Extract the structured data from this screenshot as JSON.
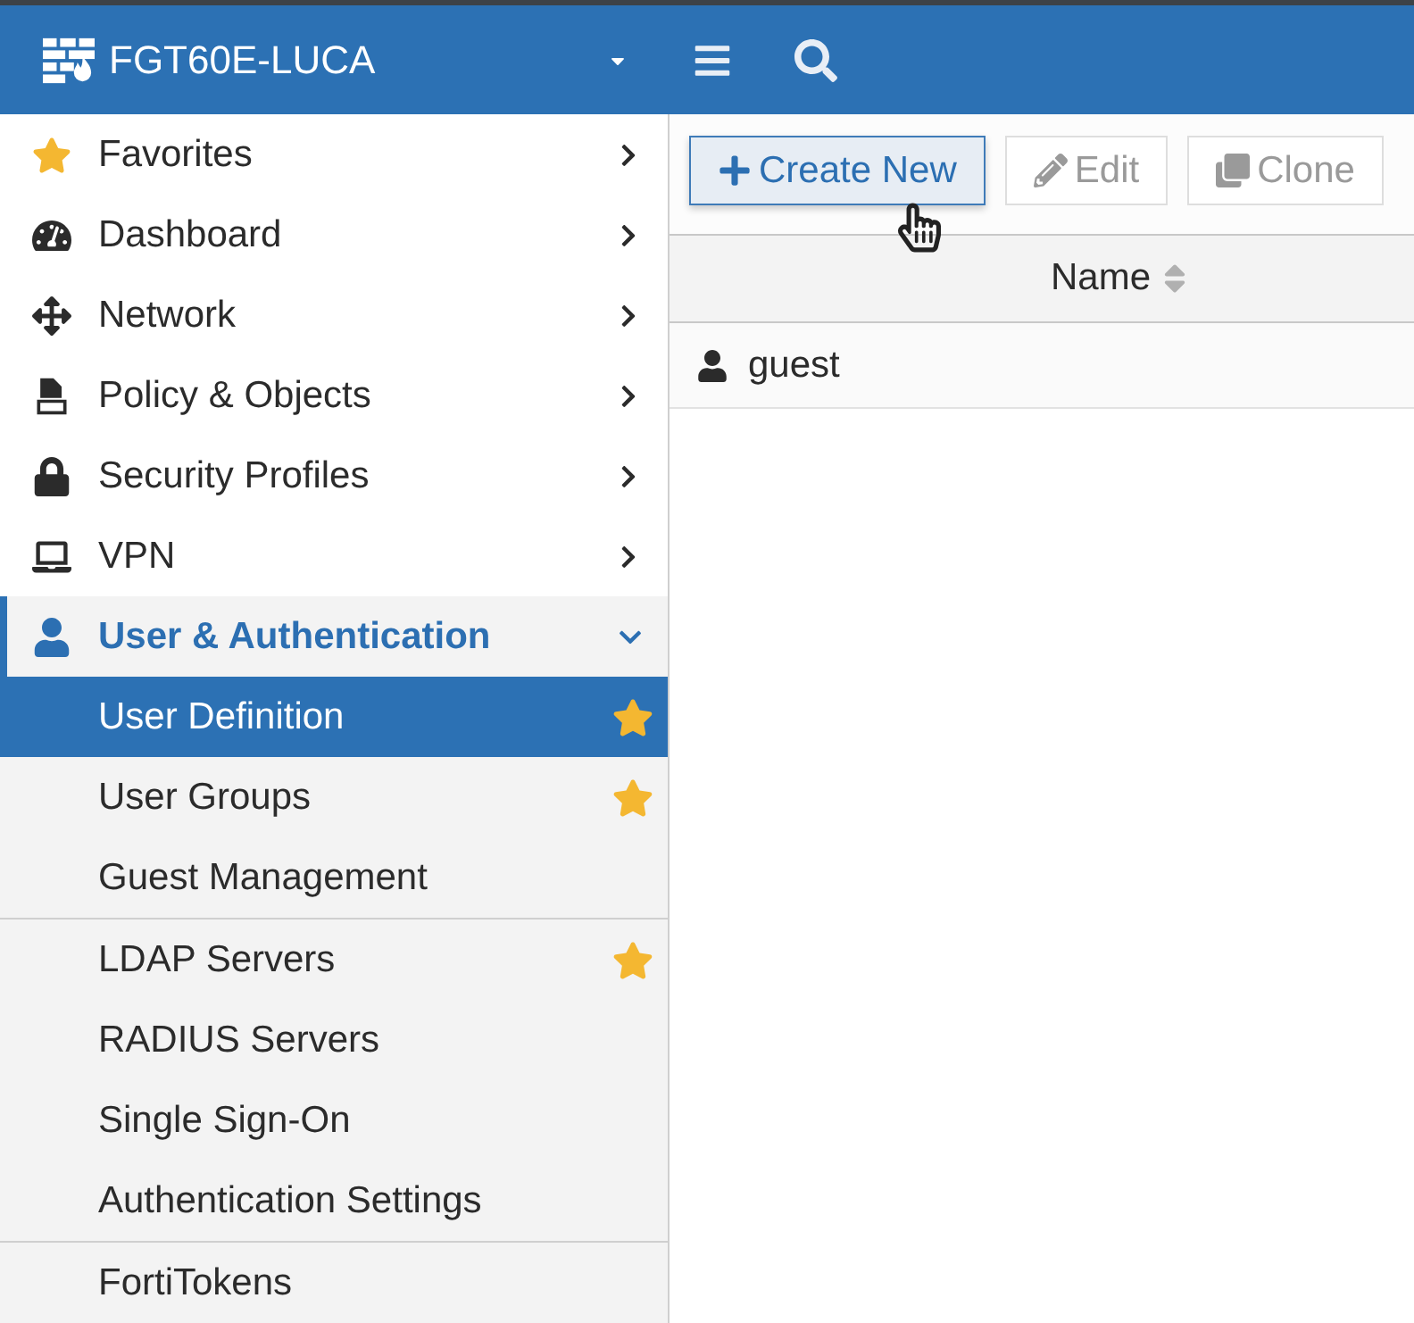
{
  "header": {
    "title": "FGT60E-LUCA"
  },
  "sidebar": {
    "items": [
      {
        "label": "Favorites",
        "expanded": false
      },
      {
        "label": "Dashboard",
        "expanded": false
      },
      {
        "label": "Network",
        "expanded": false
      },
      {
        "label": "Policy & Objects",
        "expanded": false
      },
      {
        "label": "Security Profiles",
        "expanded": false
      },
      {
        "label": "VPN",
        "expanded": false
      },
      {
        "label": "User & Authentication",
        "expanded": true,
        "sections": [
          {
            "children": [
              {
                "label": "User Definition",
                "selected": true,
                "favorite": true
              },
              {
                "label": "User Groups",
                "selected": false,
                "favorite": true
              },
              {
                "label": "Guest Management",
                "selected": false,
                "favorite": false
              }
            ]
          },
          {
            "children": [
              {
                "label": "LDAP Servers",
                "selected": false,
                "favorite": true
              },
              {
                "label": "RADIUS Servers",
                "selected": false,
                "favorite": false
              },
              {
                "label": "Single Sign-On",
                "selected": false,
                "favorite": false
              },
              {
                "label": "Authentication Settings",
                "selected": false,
                "favorite": false
              }
            ]
          },
          {
            "children": [
              {
                "label": "FortiTokens",
                "selected": false,
                "favorite": false
              }
            ]
          }
        ]
      }
    ]
  },
  "toolbar": {
    "buttons": [
      {
        "label": "Create New",
        "disabled": false,
        "hovered": true
      },
      {
        "label": "Edit",
        "disabled": true,
        "hovered": false
      },
      {
        "label": "Clone",
        "disabled": true,
        "hovered": false
      }
    ]
  },
  "table": {
    "columns": [
      {
        "label": "Name",
        "sortable": true
      }
    ],
    "rows": [
      {
        "cells": [
          "guest"
        ],
        "selected": false
      }
    ]
  }
}
